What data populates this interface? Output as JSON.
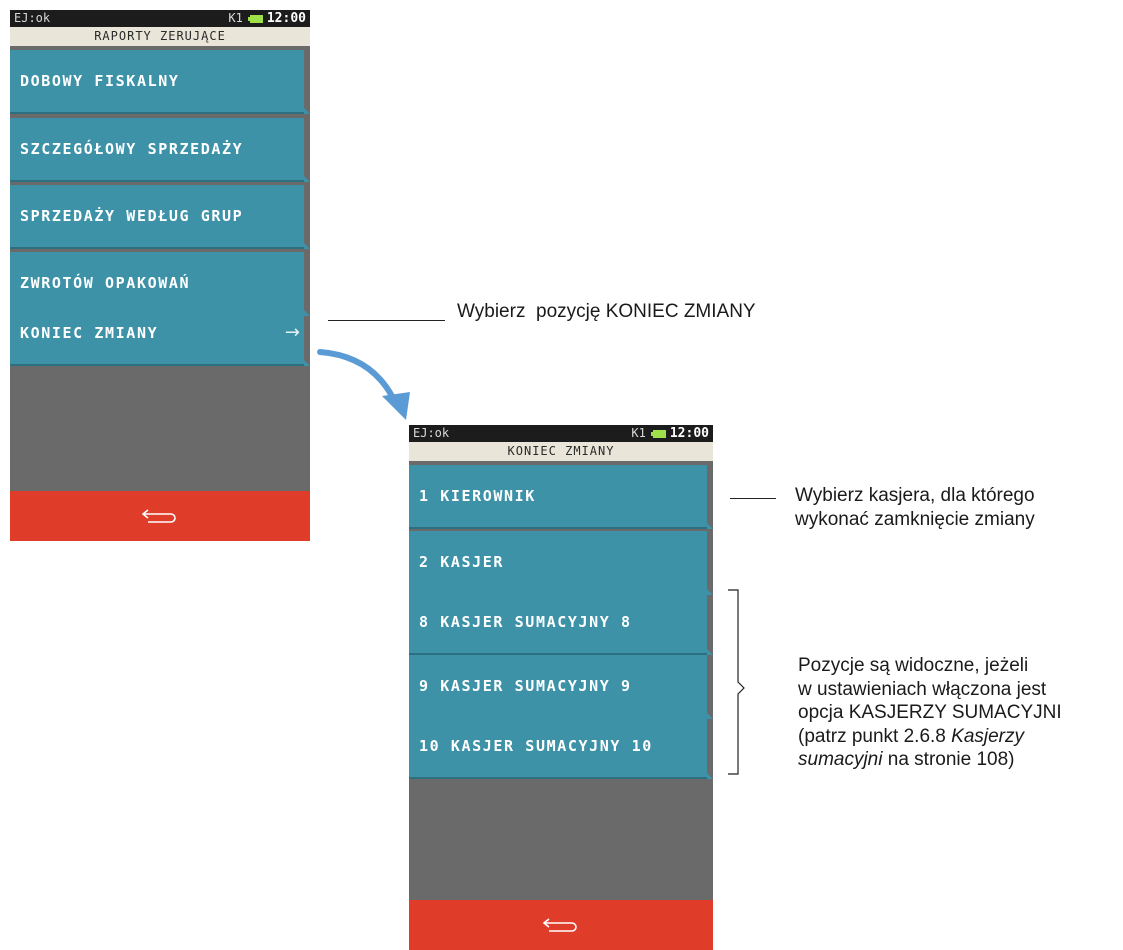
{
  "screen1": {
    "status_left": "EJ:ok",
    "status_k": "K1",
    "status_time": "12:00",
    "title": "RAPORTY ZERUJĄCE",
    "items": [
      {
        "label": "DOBOWY FISKALNY"
      },
      {
        "label": "SZCZEGÓŁOWY SPRZEDAŻY"
      },
      {
        "label": "SPRZEDAŻY WEDŁUG GRUP"
      },
      {
        "label": "ZWROTÓW OPAKOWAŃ"
      },
      {
        "label": "KONIEC ZMIANY",
        "arrow": "→"
      }
    ],
    "back_icon": "back-arrow-icon"
  },
  "screen2": {
    "status_left": "EJ:ok",
    "status_k": "K1",
    "status_time": "12:00",
    "title": "KONIEC ZMIANY",
    "items": [
      {
        "label": "1 KIEROWNIK"
      },
      {
        "label": "2 KASJER"
      },
      {
        "label": "8 KASJER SUMACYJNY 8"
      },
      {
        "label": "9 KASJER SUMACYJNY 9"
      },
      {
        "label": "10 KASJER SUMACYJNY 10"
      }
    ],
    "back_icon": "back-arrow-icon"
  },
  "annotations": {
    "select_item": "Wybierz  pozycję KONIEC ZMIANY",
    "select_cashier": [
      "Wybierz kasjera, dla którego",
      "wykonać zamknięcie zmiany"
    ],
    "visible_note": {
      "line1": "Pozycje są widoczne, jeżeli",
      "line2": "w ustawieniach włączona jest",
      "line3": "opcja KASJERZY SUMACYJNI",
      "line4_pre": "(patrz punkt 2.6.8 ",
      "line4_em": "Kasjerzy",
      "line5_em": "sumacyjni",
      "line5_post": " na stronie 108)"
    }
  },
  "colors": {
    "item_bg": "#3d92a8",
    "screen_bg": "#6b6a6b",
    "back_bar": "#e03c2a",
    "title_bg": "#e9e5d8",
    "status_bg": "#1c1c1c",
    "arrow": "#5b9bd5"
  }
}
